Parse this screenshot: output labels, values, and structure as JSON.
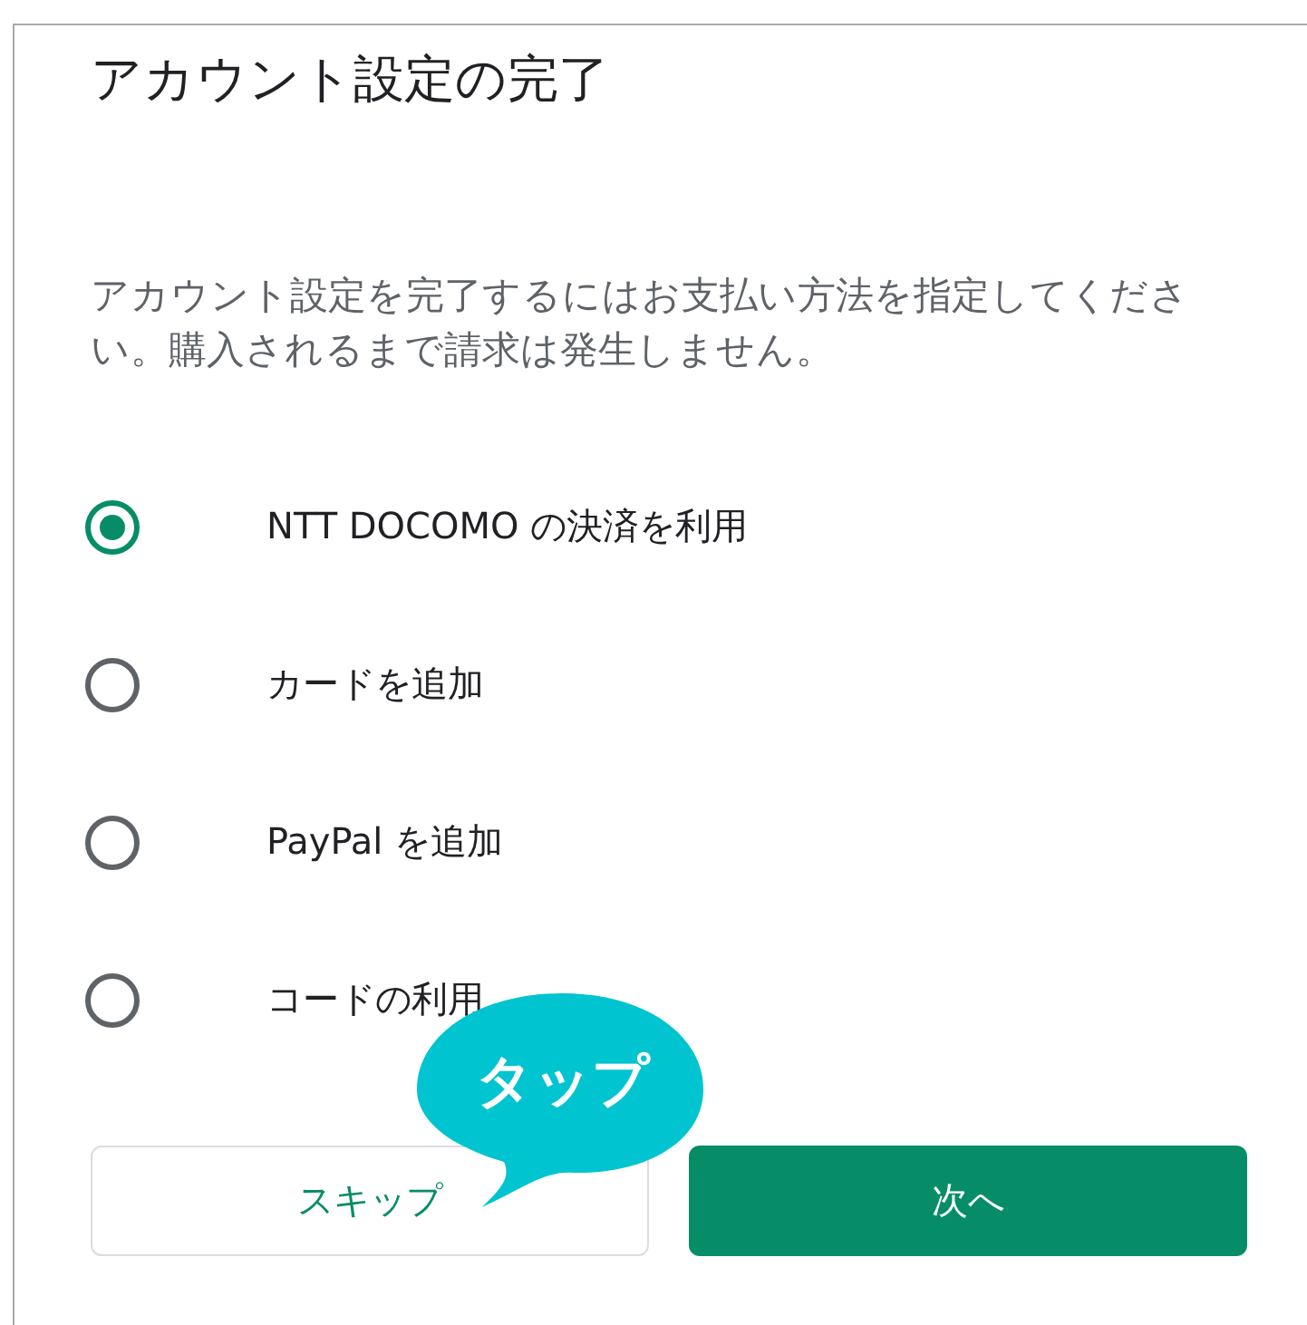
{
  "dialog": {
    "title": "アカウント設定の完了",
    "description": "アカウント設定を完了するにはお支払い方法を指定してください。購入されるまで請求は発生しません。",
    "options": [
      {
        "label": "NTT DOCOMO の決済を利用",
        "selected": true
      },
      {
        "label": "カードを追加",
        "selected": false
      },
      {
        "label": "PayPal を追加",
        "selected": false
      },
      {
        "label": "コードの利用",
        "selected": false
      }
    ],
    "buttons": [
      {
        "label": "スキップ",
        "kind": "outlined"
      },
      {
        "label": "次へ",
        "kind": "filled"
      }
    ]
  },
  "callout": {
    "label": "タップ"
  }
}
